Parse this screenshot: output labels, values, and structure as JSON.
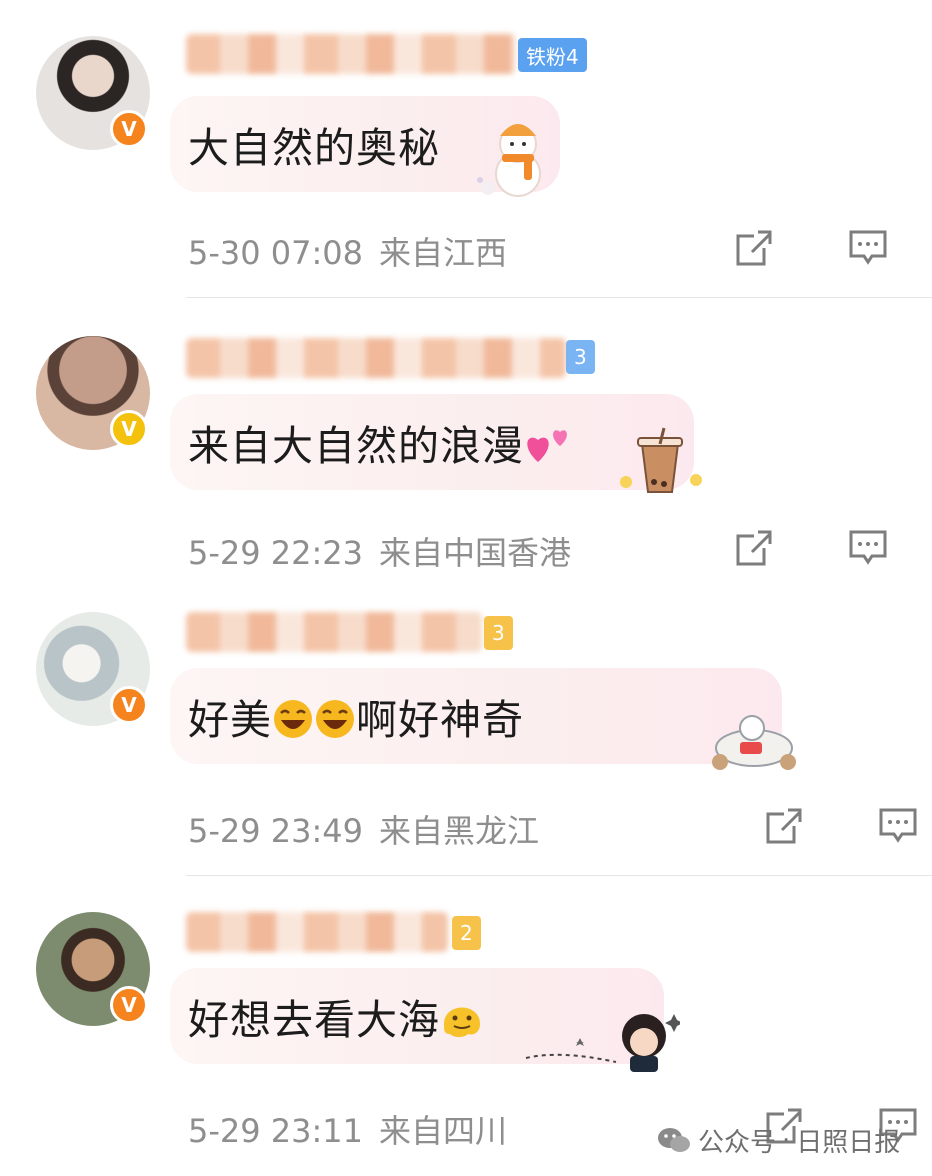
{
  "comments": [
    {
      "badge_label": "铁粉4",
      "badge_color": "#5aa2f0",
      "text": "大自然的奥秘",
      "time": "5-30 07:08",
      "location": "来自江西",
      "verified_color": "#f5841f",
      "sticker": "snowman-sticker"
    },
    {
      "badge_label": "3",
      "badge_color": "#7ab4f2",
      "text": "来自大自然的浪漫",
      "emoji": "two-hearts",
      "time": "5-29 22:23",
      "location": "来自中国香港",
      "verified_color": "#f4c20d",
      "sticker": "bubble-tea-sticker"
    },
    {
      "badge_label": "3",
      "badge_color": "#f6c24a",
      "text_before": "好美",
      "text_after": "啊好神奇",
      "emoji": "laughing-face",
      "time": "5-29 23:49",
      "location": "来自黑龙江",
      "verified_color": "#f5841f",
      "sticker": "airplane-sticker"
    },
    {
      "badge_label": "2",
      "badge_color": "#f6c24a",
      "text": "好想去看大海",
      "emoji": "melting-face",
      "time": "5-29 23:11",
      "location": "来自四川",
      "verified_color": "#f5841f",
      "sticker": "cartoon-girl-sticker"
    }
  ],
  "verified_mark": "V",
  "watermark": {
    "prefix": "公众号",
    "separator": "·",
    "name": "日照日报"
  }
}
